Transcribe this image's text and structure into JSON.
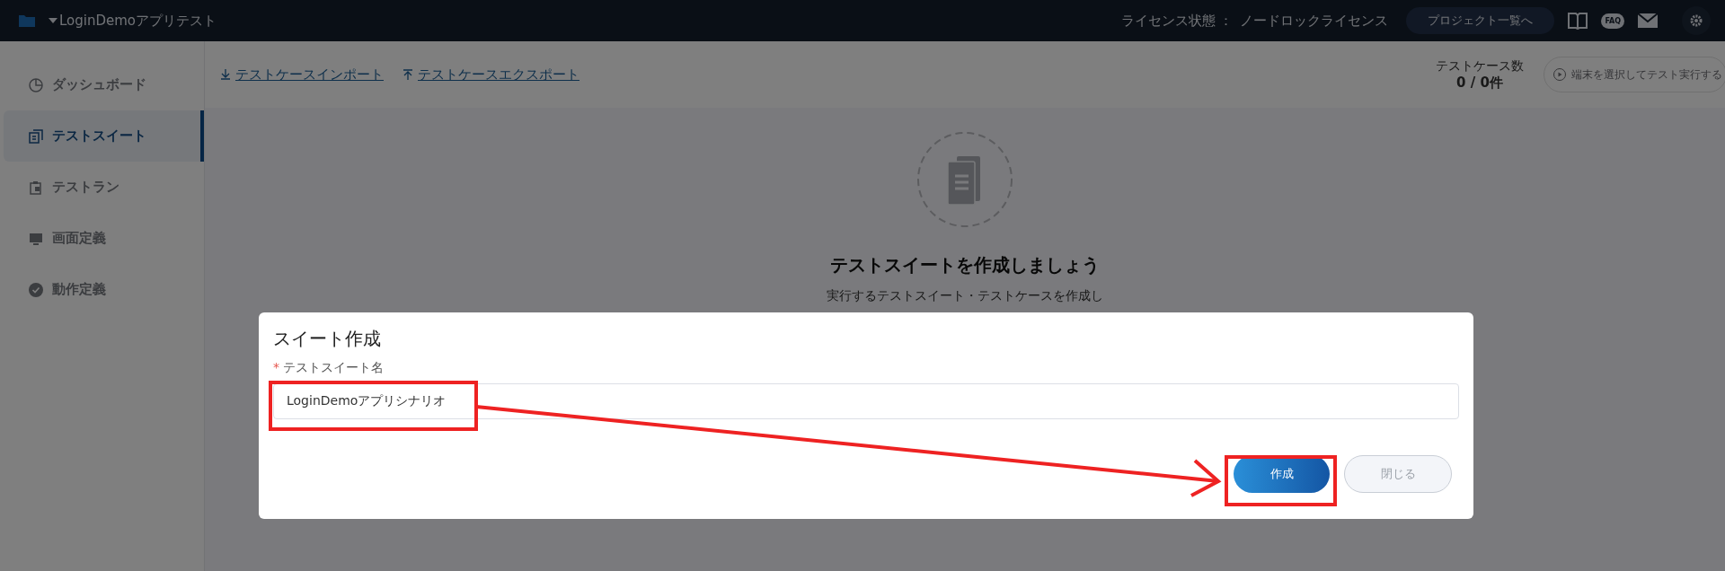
{
  "header": {
    "project": "LoginDemoアプリテスト",
    "license_label": "ライセンス状態 ：",
    "license_value": "ノードロックライセンス",
    "projects_button": "プロジェクト一覧へ",
    "faq": "FAQ"
  },
  "sidebar": [
    {
      "label": "ダッシュボード",
      "kind": "clock",
      "selected": false
    },
    {
      "label": "テストスイート",
      "kind": "suite",
      "selected": true
    },
    {
      "label": "テストラン",
      "kind": "run",
      "selected": false
    },
    {
      "label": "画面定義",
      "kind": "screen",
      "selected": false
    },
    {
      "label": "動作定義",
      "kind": "check",
      "selected": false
    }
  ],
  "toolbar": {
    "import_link": "テストケースインポート",
    "export_link": "テストケースエクスポート",
    "case_count_label": "テストケース数",
    "case_count": "0 / 0件",
    "run_button": {
      "label": "端末を選択してテスト実行する",
      "disabled": true
    }
  },
  "empty_state": {
    "heading": "テストスイートを作成しましょう",
    "description": "実行するテストスイート・テストケースを作成し"
  },
  "dialog": {
    "title": "スイート作成",
    "required_mark": "*",
    "field_label": "テストスイート名",
    "field_value": "LoginDemoアプリシナリオ",
    "create_button": "作成",
    "close_button": "閉じる"
  }
}
